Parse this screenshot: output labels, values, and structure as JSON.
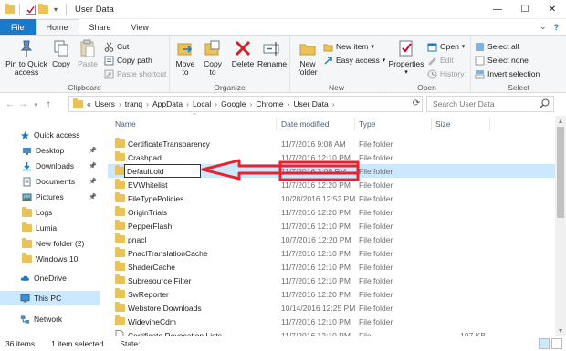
{
  "window": {
    "title": "User Data",
    "minimize_glyph": "—",
    "maximize_glyph": "☐",
    "close_glyph": "✕"
  },
  "tabs": [
    "File",
    "Home",
    "Share",
    "View"
  ],
  "tab_right": {
    "collapse_glyph": "⌄",
    "help_glyph": "?"
  },
  "ribbon": {
    "clipboard": {
      "label": "Clipboard",
      "pin": "Pin to Quick access",
      "pin_l1": "Pin to Quick",
      "pin_l2": "access",
      "copy": "Copy",
      "paste": "Paste",
      "cut": "Cut",
      "copy_path": "Copy path",
      "paste_shortcut": "Paste shortcut"
    },
    "organize": {
      "label": "Organize",
      "move_to_l1": "Move",
      "move_to_l2": "to",
      "copy_to_l1": "Copy",
      "copy_to_l2": "to",
      "delete": "Delete",
      "rename": "Rename"
    },
    "new": {
      "label": "New",
      "new_folder_l1": "New",
      "new_folder_l2": "folder",
      "new_item": "New item",
      "easy_access": "Easy access"
    },
    "open": {
      "label": "Open",
      "properties": "Properties",
      "open": "Open",
      "edit": "Edit",
      "history": "History"
    },
    "select": {
      "label": "Select",
      "select_all": "Select all",
      "select_none": "Select none",
      "invert": "Invert selection"
    }
  },
  "address": {
    "prefix": "«",
    "crumbs": [
      "Users",
      "tranq",
      "AppData",
      "Local",
      "Google",
      "Chrome",
      "User Data"
    ],
    "search_placeholder": "Search User Data"
  },
  "nav": {
    "items": [
      {
        "label": "Quick access",
        "icon": "star-icon",
        "pinned": false
      },
      {
        "label": "Desktop",
        "icon": "desktop-icon",
        "pinned": true
      },
      {
        "label": "Downloads",
        "icon": "download-icon",
        "pinned": true
      },
      {
        "label": "Documents",
        "icon": "document-icon",
        "pinned": true
      },
      {
        "label": "Pictures",
        "icon": "picture-icon",
        "pinned": true
      },
      {
        "label": "Logs",
        "icon": "folder-icon",
        "pinned": false
      },
      {
        "label": "Lumia",
        "icon": "folder-icon",
        "pinned": false
      },
      {
        "label": "New folder (2)",
        "icon": "folder-icon",
        "pinned": false
      },
      {
        "label": "Windows 10",
        "icon": "folder-icon",
        "pinned": false
      },
      {
        "label": "OneDrive",
        "icon": "cloud-icon",
        "pinned": false
      },
      {
        "label": "This PC",
        "icon": "computer-icon",
        "pinned": false
      },
      {
        "label": "Network",
        "icon": "network-icon",
        "pinned": false
      }
    ]
  },
  "columns": {
    "name": "Name",
    "date": "Date modified",
    "type": "Type",
    "size": "Size"
  },
  "files": [
    {
      "name": "CertificateTransparency",
      "date": "11/7/2016 9:08 AM",
      "type": "File folder",
      "size": ""
    },
    {
      "name": "Crashpad",
      "date": "11/7/2016 12:10 PM",
      "type": "File folder",
      "size": ""
    },
    {
      "name": "Default.old",
      "date": "11/7/2016 3:09 PM",
      "type": "File folder",
      "size": "",
      "renaming": true
    },
    {
      "name": "EVWhitelist",
      "date": "11/7/2016 12:20 PM",
      "type": "File folder",
      "size": ""
    },
    {
      "name": "FileTypePolicies",
      "date": "10/28/2016 12:52 PM",
      "type": "File folder",
      "size": ""
    },
    {
      "name": "OriginTrials",
      "date": "11/7/2016 12:20 PM",
      "type": "File folder",
      "size": ""
    },
    {
      "name": "PepperFlash",
      "date": "11/7/2016 12:10 PM",
      "type": "File folder",
      "size": ""
    },
    {
      "name": "pnacl",
      "date": "10/7/2016 12:20 PM",
      "type": "File folder",
      "size": ""
    },
    {
      "name": "PnaclTranslationCache",
      "date": "11/7/2016 12:10 PM",
      "type": "File folder",
      "size": ""
    },
    {
      "name": "ShaderCache",
      "date": "11/7/2016 12:10 PM",
      "type": "File folder",
      "size": ""
    },
    {
      "name": "Subresource Filter",
      "date": "11/7/2016 12:10 PM",
      "type": "File folder",
      "size": ""
    },
    {
      "name": "SwReporter",
      "date": "11/7/2016 12:20 PM",
      "type": "File folder",
      "size": ""
    },
    {
      "name": "Webstore Downloads",
      "date": "10/14/2016 12:25 PM",
      "type": "File folder",
      "size": ""
    },
    {
      "name": "WidevineCdm",
      "date": "11/7/2016 12:10 PM",
      "type": "File folder",
      "size": ""
    },
    {
      "name": "Certificate Revocation Lists",
      "date": "11/7/2016 12:10 PM",
      "type": "File",
      "size": "197 KB"
    }
  ],
  "status": {
    "count": "36 items",
    "selected": "1 item selected",
    "state": "State:"
  },
  "colors": {
    "accent": "#1979ca",
    "selection": "#cce8ff",
    "annotation": "#e8222e"
  }
}
